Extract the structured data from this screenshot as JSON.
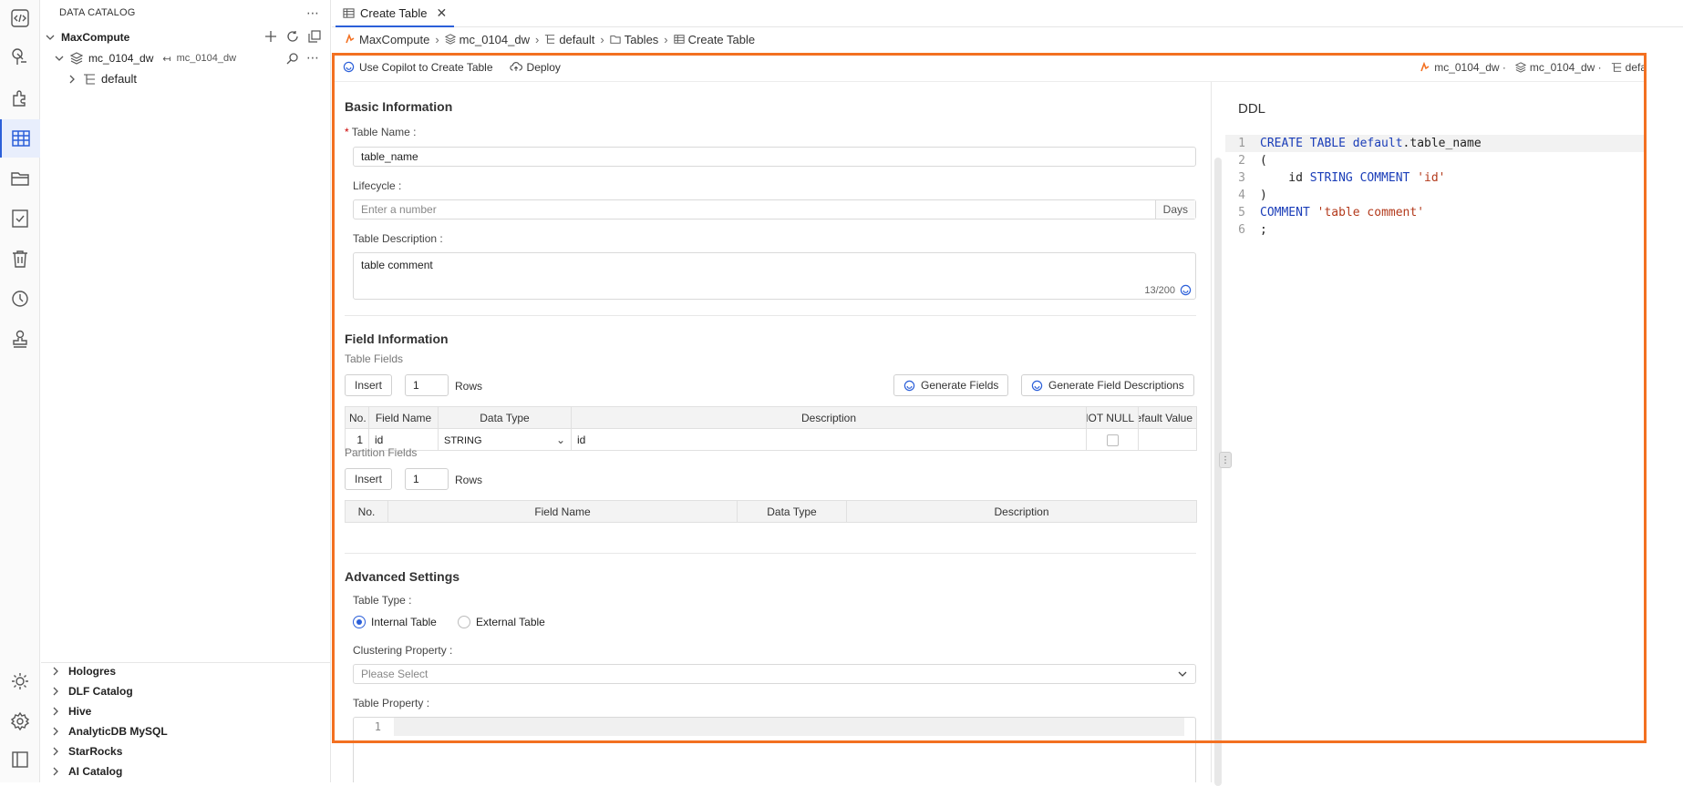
{
  "catalog": {
    "title": "DATA CATALOG",
    "root": "MaxCompute",
    "project": "mc_0104_dw",
    "project_link": "mc_0104_dw",
    "schema": "default",
    "bottom_items": [
      "Hologres",
      "DLF Catalog",
      "Hive",
      "AnalyticDB MySQL",
      "StarRocks",
      "AI Catalog"
    ]
  },
  "tab": {
    "label": "Create Table"
  },
  "breadcrumb": [
    "MaxCompute",
    "mc_0104_dw",
    "default",
    "Tables",
    "Create Table"
  ],
  "toolbar": {
    "copilot_label": "Use Copilot to Create Table",
    "deploy_label": "Deploy",
    "context1": "mc_0104_dw ·",
    "context2": "mc_0104_dw ·",
    "context3": "defa"
  },
  "basic": {
    "heading": "Basic Information",
    "table_name_label": "Table Name :",
    "table_name_value": "table_name",
    "lifecycle_label": "Lifecycle :",
    "lifecycle_placeholder": "Enter a number",
    "lifecycle_unit": "Days",
    "description_label": "Table Description :",
    "description_value": "table comment",
    "description_count": "13/200"
  },
  "fields": {
    "heading": "Field Information",
    "sub": "Table Fields",
    "insert_label": "Insert",
    "insert_count": "1",
    "rows_label": "Rows",
    "generate_fields_label": "Generate Fields",
    "generate_desc_label": "Generate Field Descriptions",
    "columns": [
      "No.",
      "Field Name",
      "Data Type",
      "Description",
      "NOT NULL",
      "Default Value"
    ],
    "rows": [
      {
        "no": "1",
        "name": "id",
        "type": "STRING",
        "description": "id"
      }
    ]
  },
  "partition": {
    "sub": "Partition Fields",
    "insert_label": "Insert",
    "insert_count": "1",
    "rows_label": "Rows",
    "columns": [
      "No.",
      "Field Name",
      "Data Type",
      "Description"
    ]
  },
  "advanced": {
    "heading": "Advanced Settings",
    "table_type_label": "Table Type :",
    "internal_label": "Internal Table",
    "external_label": "External Table",
    "clustering_label": "Clustering Property :",
    "clustering_placeholder": "Please Select",
    "property_label": "Table Property :",
    "property_line": "1"
  },
  "ddl": {
    "title": "DDL",
    "lines": [
      {
        "n": "1",
        "parts": [
          [
            "kw",
            "CREATE TABLE "
          ],
          [
            "kw",
            "default"
          ],
          [
            "pl",
            ".table_name"
          ]
        ]
      },
      {
        "n": "2",
        "parts": [
          [
            "pl",
            "("
          ]
        ]
      },
      {
        "n": "3",
        "parts": [
          [
            "pl",
            "    id "
          ],
          [
            "kw",
            "STRING COMMENT "
          ],
          [
            "str",
            "'id'"
          ]
        ]
      },
      {
        "n": "4",
        "parts": [
          [
            "pl",
            ")"
          ]
        ]
      },
      {
        "n": "5",
        "parts": [
          [
            "kw",
            "COMMENT "
          ],
          [
            "str",
            "'table comment'"
          ]
        ]
      },
      {
        "n": "6",
        "parts": [
          [
            "pl",
            ";"
          ]
        ]
      }
    ]
  },
  "colors": {
    "accent": "#2b5fd9",
    "highlight": "#f37021",
    "keyword": "#1a3db8",
    "string": "#b33a1c",
    "brand": "#f37021"
  }
}
